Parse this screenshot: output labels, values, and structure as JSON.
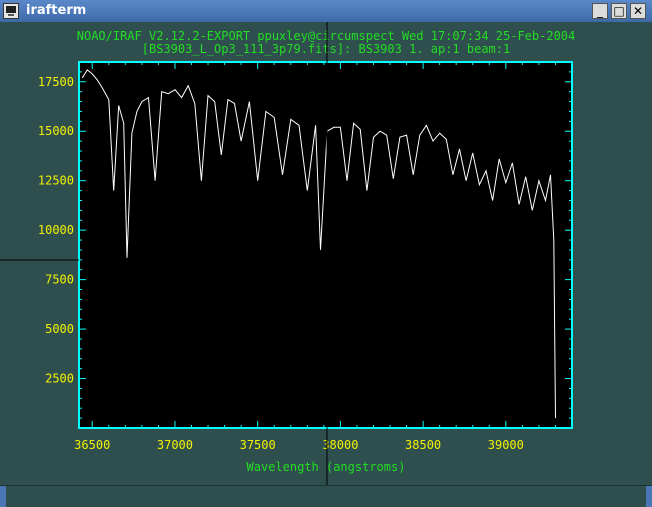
{
  "window": {
    "title": "irafterm",
    "minimize_label": "_",
    "maximize_label": "□",
    "close_label": "✕",
    "icon": "irafterm-app-icon"
  },
  "header": {
    "line1": "NOAO/IRAF V2.12.2-EXPORT ppuxley@circumspect Wed 17:07:34 25-Feb-2004",
    "line2": "[BS3903_L_Op3_111_3p79.fits]: BS3903 1. ap:1 beam:1"
  },
  "colors": {
    "frame": "#00ffff",
    "header_text": "#22dd22",
    "tick_labels": "#f2f200",
    "trace": "#ffffff",
    "background": "#2f4f4f"
  },
  "chart_data": {
    "type": "line",
    "xlabel": "Wavelength (angstroms)",
    "ylabel": "",
    "xlim": [
      36420,
      39400
    ],
    "ylim": [
      0,
      18500
    ],
    "x_ticks": [
      36500,
      37000,
      37500,
      38000,
      38500,
      39000
    ],
    "y_ticks": [
      2500,
      5000,
      7500,
      10000,
      12500,
      15000,
      17500
    ],
    "x_tick_labels": [
      "36500",
      "37000",
      "37500",
      "38000",
      "38500",
      "39000"
    ],
    "y_tick_labels": [
      "2500",
      "5000",
      "7500",
      "10000",
      "12500",
      "15000",
      "17500"
    ],
    "grid": false,
    "series": [
      {
        "values_x": [
          36440,
          36470,
          36500,
          36530,
          36560,
          36600,
          36630,
          36660,
          36690,
          36710,
          36740,
          36770,
          36800,
          36840,
          36880,
          36920,
          36960,
          37000,
          37040,
          37080,
          37120,
          37160,
          37200,
          37240,
          37280,
          37320,
          37360,
          37400,
          37450,
          37500,
          37550,
          37600,
          37650,
          37700,
          37750,
          37800,
          37850,
          37880,
          37920,
          37960,
          38000,
          38040,
          38080,
          38120,
          38160,
          38200,
          38240,
          38280,
          38320,
          38360,
          38400,
          38440,
          38480,
          38520,
          38560,
          38600,
          38640,
          38680,
          38720,
          38760,
          38800,
          38840,
          38880,
          38920,
          38960,
          39000,
          39040,
          39080,
          39120,
          39160,
          39200,
          39240,
          39270,
          39290,
          39300
        ],
        "values_y": [
          17700,
          18100,
          17900,
          17600,
          17200,
          16600,
          12000,
          16300,
          15400,
          8600,
          14900,
          16000,
          16500,
          16700,
          12500,
          17000,
          16900,
          17100,
          16700,
          17300,
          16400,
          12500,
          16800,
          16500,
          13800,
          16600,
          16400,
          14500,
          16500,
          12500,
          16000,
          15700,
          12800,
          15600,
          15300,
          12000,
          15300,
          9000,
          15000,
          15200,
          15200,
          12500,
          15400,
          15100,
          12000,
          14700,
          15000,
          14800,
          12600,
          14700,
          14800,
          12800,
          14800,
          15300,
          14500,
          14900,
          14600,
          12800,
          14100,
          12500,
          13900,
          12300,
          13000,
          11500,
          13600,
          12400,
          13400,
          11300,
          12700,
          11000,
          12500,
          11500,
          12800,
          9500,
          500
        ]
      }
    ]
  }
}
